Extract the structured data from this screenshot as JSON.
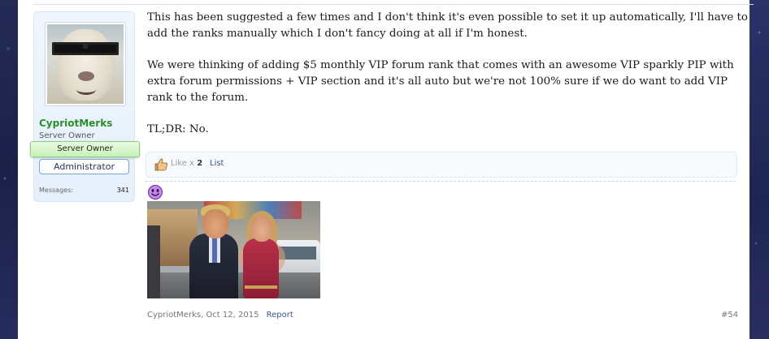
{
  "user": {
    "name": "CypriotMerks",
    "title": "Server Owner",
    "banner_primary": "Server Owner",
    "banner_secondary": "Administrator",
    "stats": [
      {
        "label": "Messages:",
        "value": "341"
      }
    ]
  },
  "message": {
    "paragraphs": [
      "This has been suggested a few times and I don't think it's even possible to set it up automatically, I'll have to add the ranks manually which I don't fancy doing at all if I'm honest.",
      "We were thinking of adding $5 monthly VIP forum rank that comes with an awesome VIP sparkly PIP with extra forum permissions + VIP section and it's all auto but we're not 100% sure if we do want to add VIP rank to the forum.",
      "TL;DR: No."
    ]
  },
  "likes": {
    "label": "Like x",
    "count": "2",
    "list_label": "List"
  },
  "meta": {
    "author": "CypriotMerks",
    "date": "Oct 12, 2015",
    "report_label": "Report",
    "post_number": "#54"
  },
  "icons": {
    "like": "thumbs-up-icon",
    "smiley": "purple-smiley-icon"
  },
  "colors": {
    "username": "#2a8e2a",
    "link": "#35598c",
    "panel_bg": "#e6f0fb",
    "owner_banner": "#c8f2b8"
  }
}
